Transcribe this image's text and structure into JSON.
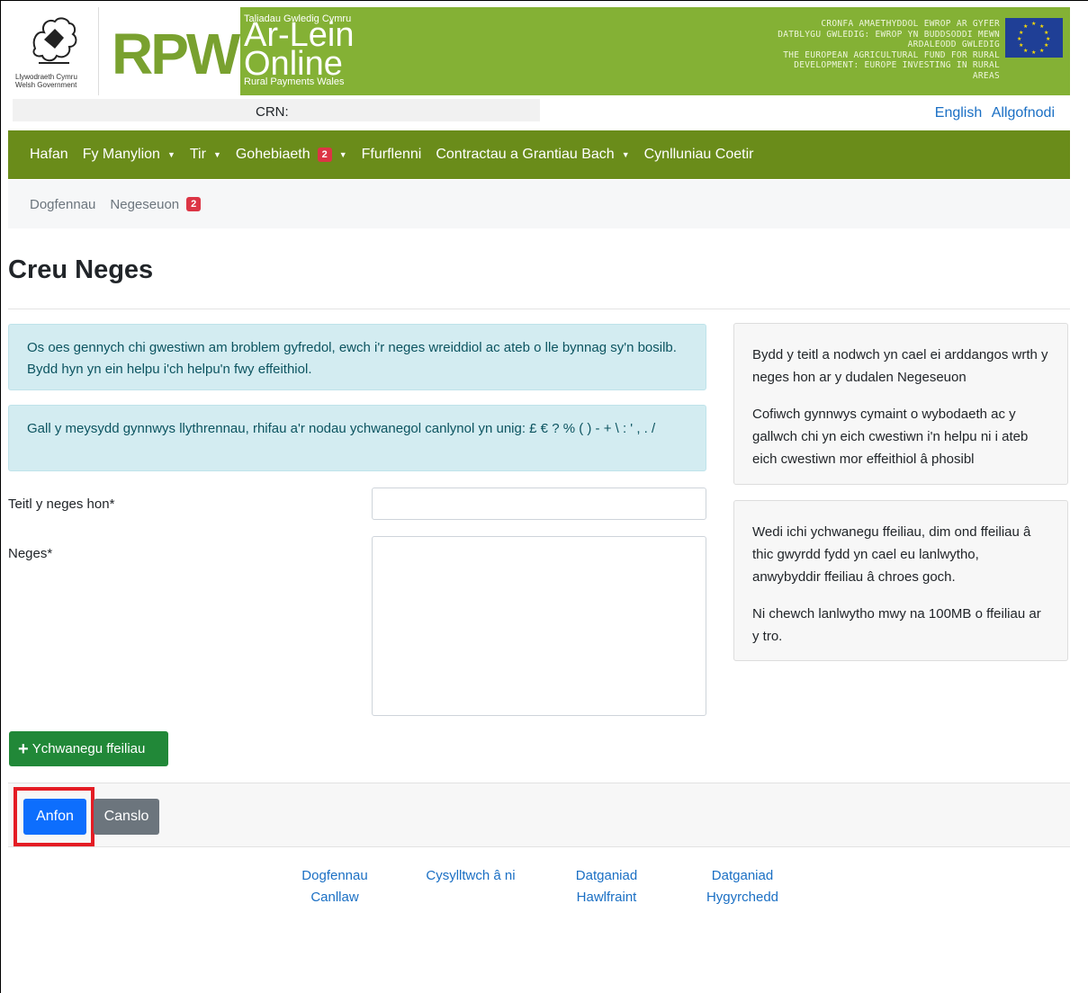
{
  "header": {
    "gov_line1": "Llywodraeth Cymru",
    "gov_line2": "Welsh Government",
    "logo": "RPW",
    "tagline": "Taliadau Gwledig Cymru",
    "arlein": "Ar-Lein",
    "online": "Online",
    "rural_payments": "Rural Payments Wales",
    "eu_cy": "CRONFA AMAETHYDDOL EWROP AR GYFER DATBLYGU GWLEDIG: EWROP YN BUDDSODDI MEWN ARDALEODD GWLEDIG",
    "eu_en": "THE EUROPEAN AGRICULTURAL FUND FOR RURAL DEVELOPMENT: EUROPE INVESTING IN RURAL AREAS"
  },
  "account": {
    "crn_label": "CRN:",
    "language_link": "English",
    "logout_link": "Allgofnodi"
  },
  "nav": {
    "items": [
      "Hafan",
      "Fy Manylion",
      "Tir",
      "Gohebiaeth",
      "Ffurflenni",
      "Contractau a Grantiau Bach",
      "Cynlluniau Coetir"
    ],
    "gohebiaeth_badge": "2"
  },
  "subnav": {
    "items": [
      "Dogfennau",
      "Negeseuon"
    ],
    "negeseuon_badge": "2"
  },
  "page": {
    "title": "Creu Neges",
    "alert1": "Os oes gennych chi gwestiwn am broblem gyfredol, ewch i'r neges wreiddiol ac ateb o lle bynnag sy'n bosilb. Bydd hyn yn ein helpu i'ch helpu'n fwy effeithiol.",
    "alert2": "Gall y meysydd gynnwys llythrennau, rhifau a'r nodau ychwanegol canlynol yn unig: £ € ? % ( ) - + \\ : ' , . /",
    "title_label": "Teitl y neges hon*",
    "title_value": "",
    "message_label": "Neges*",
    "message_value": "",
    "side1_p1": "Bydd y teitl a nodwch yn cael ei arddangos wrth y neges hon ar y dudalen Negeseuon",
    "side1_p2": "Cofiwch gynnwys cymaint o wybodaeth ac y gallwch chi yn eich cwestiwn i'n helpu ni i ateb eich cwestiwn mor effeithiol â phosibl",
    "side2_p1": "Wedi ichi ychwanegu ffeiliau, dim ond ffeiliau â thic gwyrdd fydd yn cael eu lanlwytho, anwybyddir ffeiliau â chroes goch.",
    "side2_p2": "Ni chewch lanlwytho mwy na 100MB o ffeiliau ar y tro.",
    "add_files_label": "Ychwanegu ffeiliau",
    "send_label": "Anfon",
    "cancel_label": "Canslo"
  },
  "footer": {
    "link1_line1": "Dogfennau",
    "link1_line2": "Canllaw",
    "link2": "Cysylltwch â ni",
    "link3_line1": "Datganiad",
    "link3_line2": "Hawlfraint",
    "link4_line1": "Datganiad",
    "link4_line2": "Hygyrchedd"
  },
  "colors": {
    "banner_green": "#84b135",
    "nav_green": "#6a8c1a",
    "primary": "#0d6efd",
    "success": "#218838",
    "highlight": "#e41c24"
  }
}
